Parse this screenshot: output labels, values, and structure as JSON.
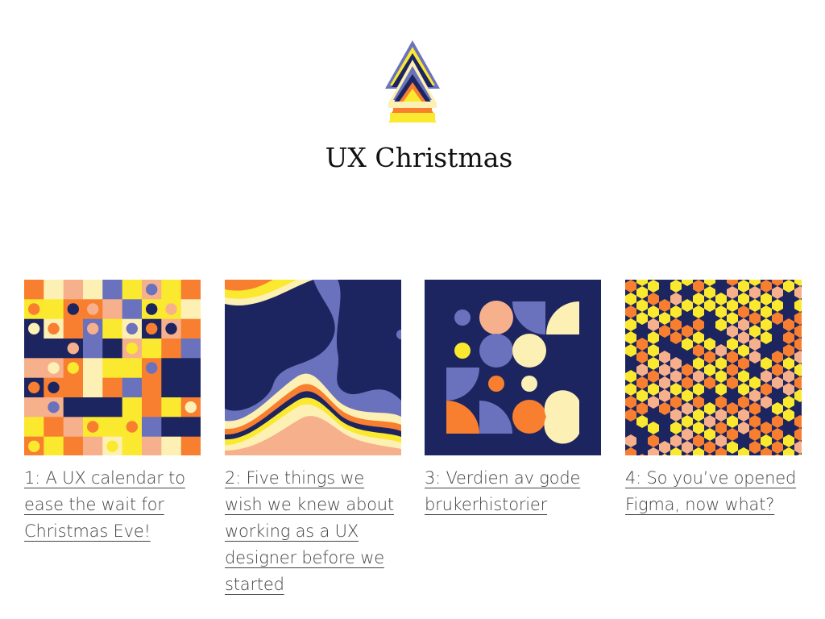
{
  "site": {
    "title": "UX Christmas",
    "logo_icon": "layered-triangle-tree-icon"
  },
  "palette": {
    "navy": "#1d2560",
    "periwinkle": "#6a72bd",
    "orange": "#f77f2f",
    "peach": "#f7b08c",
    "yellow": "#fbe92f",
    "cream": "#fdf0b4"
  },
  "articles": [
    {
      "number": 1,
      "title": "1: A UX calendar to ease the wait for Christmas Eve!",
      "thumbnail": "grid-of-squares-and-dots-pattern"
    },
    {
      "number": 2,
      "title": "2: Five things we wish we knew about working as a UX designer before we started",
      "thumbnail": "wavy-stripes-pattern"
    },
    {
      "number": 3,
      "title": "3: Verdien av gode brukerhistorier",
      "thumbnail": "circles-and-quarter-circles-pattern"
    },
    {
      "number": 4,
      "title": "4: So you’ve opened Figma, now what?",
      "thumbnail": "isometric-cubes-pattern"
    }
  ]
}
